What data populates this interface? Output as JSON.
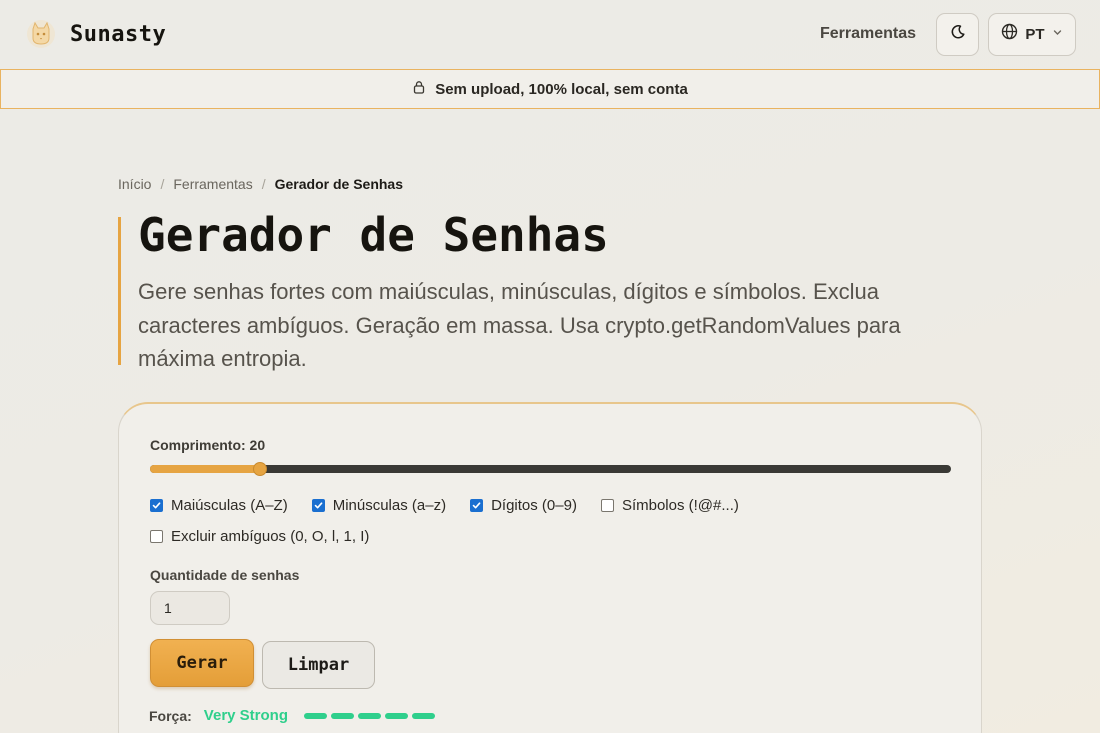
{
  "brand": {
    "name": "Sunasty"
  },
  "nav": {
    "tools_link": "Ferramentas",
    "language": "PT"
  },
  "banner": {
    "text": "Sem upload, 100% local, sem conta"
  },
  "breadcrumb": {
    "home": "Início",
    "tools": "Ferramentas",
    "current": "Gerador de Senhas"
  },
  "hero": {
    "title": "Gerador de Senhas",
    "description": "Gere senhas fortes com maiúsculas, minúsculas, dígitos e símbolos. Exclua caracteres ambíguos. Geração em massa. Usa crypto.getRandomValues para máxima entropia."
  },
  "form": {
    "length_label": "Comprimento: 20",
    "length_value": 20,
    "length_fraction": 0.1375,
    "options": [
      {
        "label": "Maiúsculas (A–Z)",
        "checked": true
      },
      {
        "label": "Minúsculas (a–z)",
        "checked": true
      },
      {
        "label": "Dígitos (0–9)",
        "checked": true
      },
      {
        "label": "Símbolos (!@#...)",
        "checked": false
      }
    ],
    "exclude_ambiguous": {
      "label": "Excluir ambíguos (0, O, l, 1, I)",
      "checked": false
    },
    "quantity_label": "Quantidade de senhas",
    "quantity_value": "1",
    "generate_label": "Gerar",
    "clear_label": "Limpar"
  },
  "strength": {
    "label": "Força:",
    "value": "Very Strong",
    "level": 5,
    "max": 5,
    "color": "#2fcf8c"
  },
  "colors": {
    "accent": "#e6a442",
    "checkbox": "#1a6fd0"
  }
}
